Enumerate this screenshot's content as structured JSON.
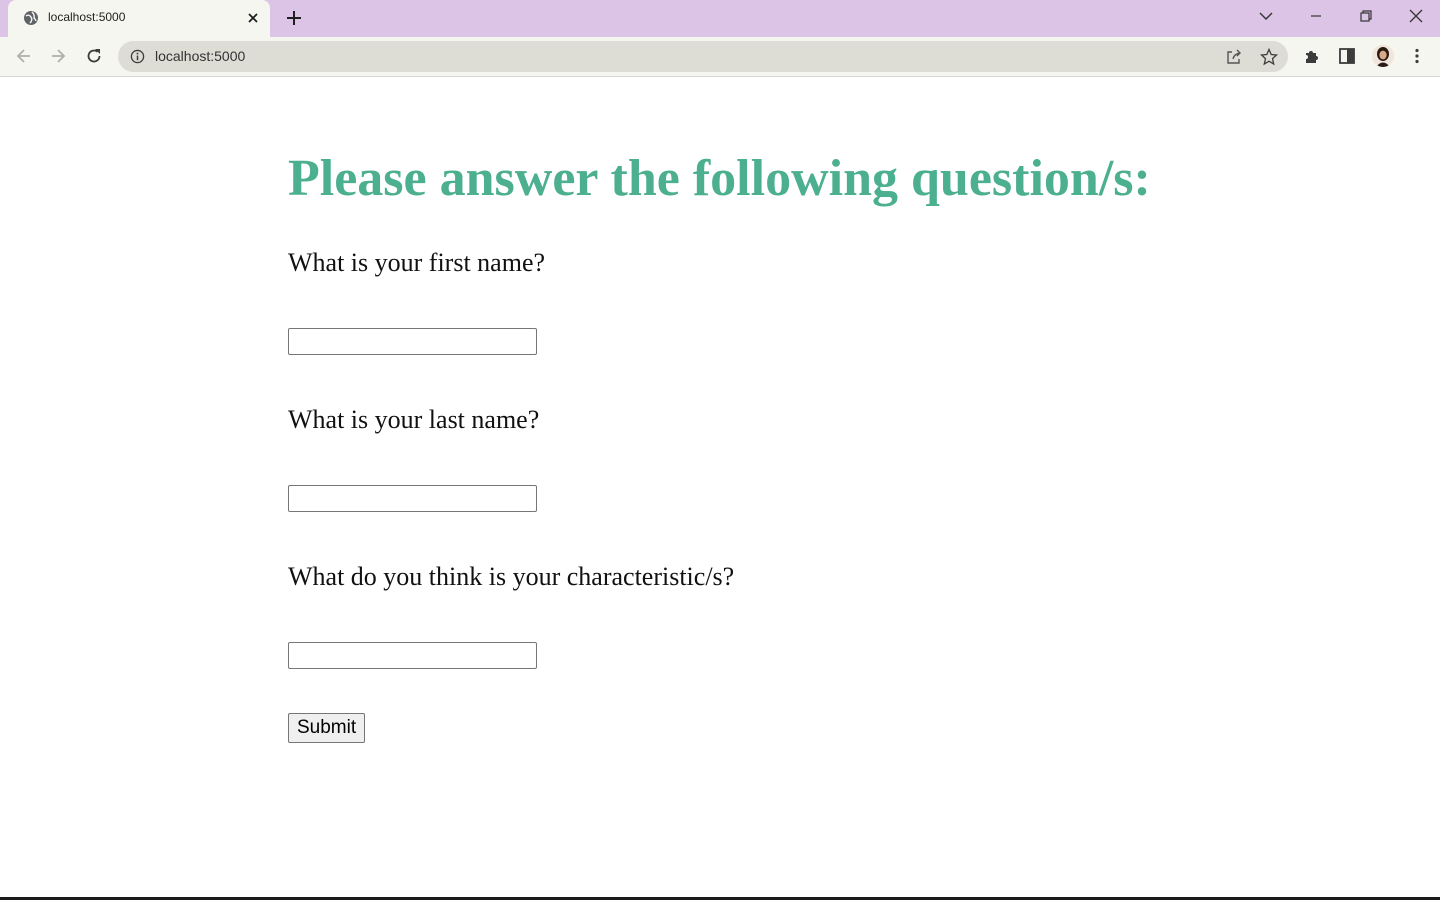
{
  "browser": {
    "tab_title": "localhost:5000",
    "url": "localhost:5000"
  },
  "icons": {
    "favicon": "globe-icon",
    "tab_close": "close-icon",
    "new_tab": "plus-icon",
    "tab_search": "chevron-down-icon",
    "minimize": "minimize-icon",
    "restore": "restore-icon",
    "close_window": "close-icon",
    "back": "arrow-left-icon",
    "forward": "arrow-right-icon",
    "reload": "reload-icon",
    "site_info": "info-icon",
    "share": "share-icon",
    "bookmark": "star-icon",
    "extensions": "puzzle-icon",
    "side_panel": "side-panel-icon",
    "profile": "avatar",
    "menu": "kebab-menu-icon"
  },
  "colors": {
    "heading": "#4caf8f",
    "titlebar": "#dbc4e6",
    "toolbar": "#f6f6f1"
  },
  "page": {
    "heading": "Please answer the following question/s:",
    "questions": [
      {
        "label": "What is your first name?",
        "value": ""
      },
      {
        "label": "What is your last name?",
        "value": ""
      },
      {
        "label": "What do you think is your characteristic/s?",
        "value": ""
      }
    ],
    "submit_label": "Submit"
  }
}
